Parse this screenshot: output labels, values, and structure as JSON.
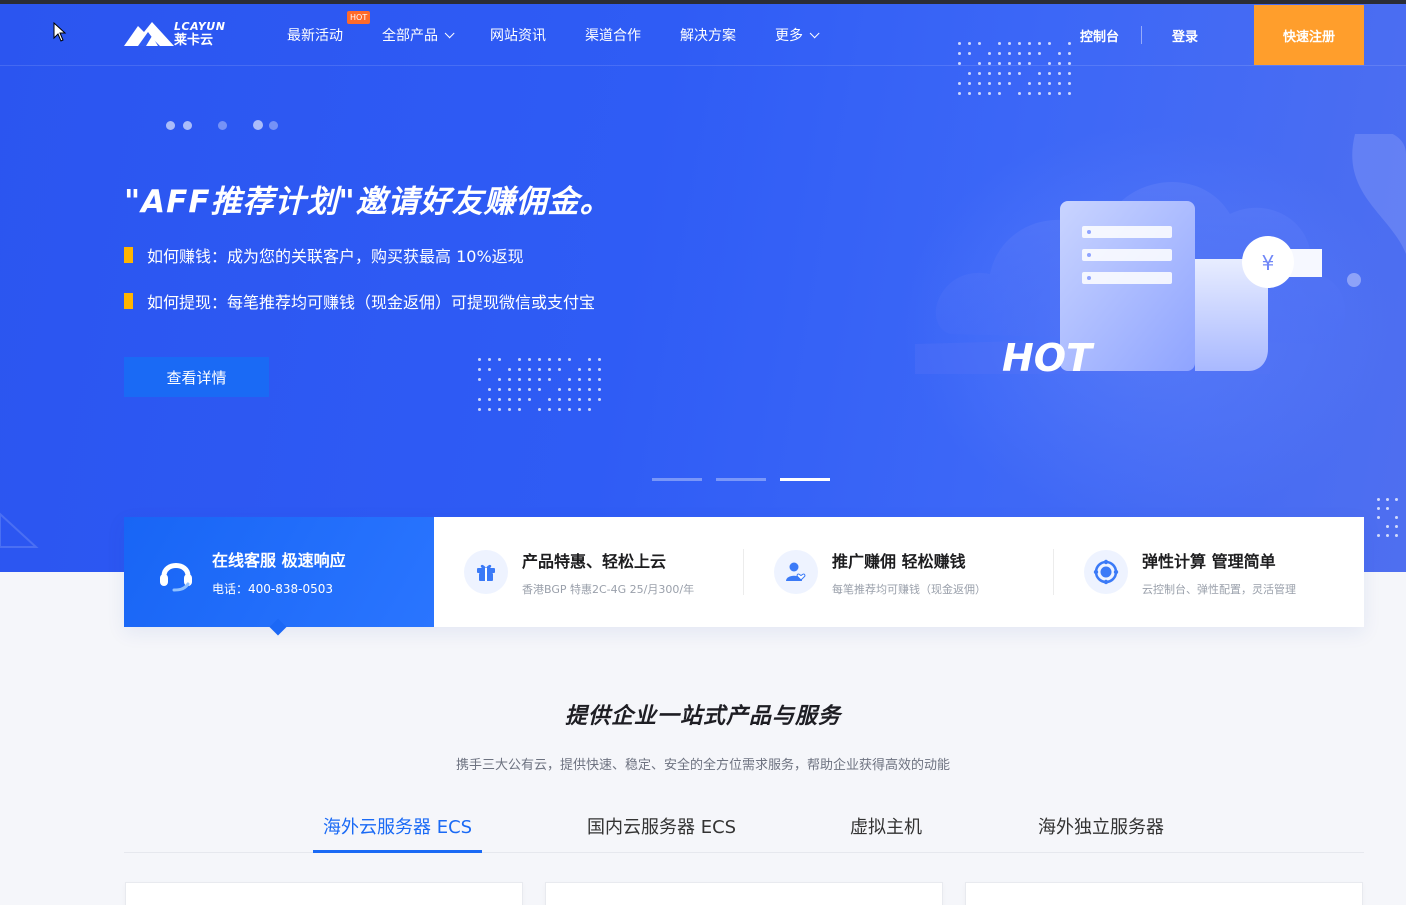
{
  "brand": {
    "en": "LCAYUN",
    "cn": "莱卡云"
  },
  "nav": {
    "items": [
      {
        "label": "最新活动",
        "badge": "HOT"
      },
      {
        "label": "全部产品",
        "dropdown": true
      },
      {
        "label": "网站资讯"
      },
      {
        "label": "渠道合作"
      },
      {
        "label": "解决方案"
      },
      {
        "label": "更多",
        "dropdown": true
      }
    ],
    "console": "控制台",
    "login": "登录",
    "register": "快速注册"
  },
  "hero": {
    "title": "\"AFF推荐计划\"邀请好友赚佣金。",
    "line1": "如何赚钱：成为您的关联客户，购买获最高 10%返现",
    "line2": "如何提现：每笔推荐均可赚钱（现金返佣）可提现微信或支付宝",
    "button": "查看详情",
    "illustration_text": "HOT",
    "currency_symbol": "¥",
    "active_slide": 3,
    "slide_count": 3
  },
  "features": [
    {
      "title": "在线客服 极速响应",
      "sub": "电话：400-838-0503",
      "icon": "headset-icon"
    },
    {
      "title": "产品特惠、轻松上云",
      "sub": "香港BGP 特惠2C-4G 25/月300/年",
      "icon": "gift-icon"
    },
    {
      "title": "推广赚佣 轻松赚钱",
      "sub": "每笔推荐均可赚钱（现金返佣）",
      "icon": "user-heart-icon"
    },
    {
      "title": "弹性计算 管理简单",
      "sub": "云控制台、弹性配置，灵活管理",
      "icon": "orbit-icon"
    }
  ],
  "section": {
    "title": "提供企业一站式产品与服务",
    "subtitle": "携手三大公有云，提供快速、稳定、安全的全方位需求服务，帮助企业获得高效的动能"
  },
  "tabs": [
    {
      "label": "海外云服务器 ECS",
      "active": true
    },
    {
      "label": "国内云服务器 ECS",
      "active": false
    },
    {
      "label": "虚拟主机",
      "active": false
    },
    {
      "label": "海外独立服务器",
      "active": false
    }
  ],
  "colors": {
    "primary": "#1a6af5",
    "hero": "#2f5cf5",
    "accent": "#ff9e2c",
    "bullet": "#ffb400"
  }
}
